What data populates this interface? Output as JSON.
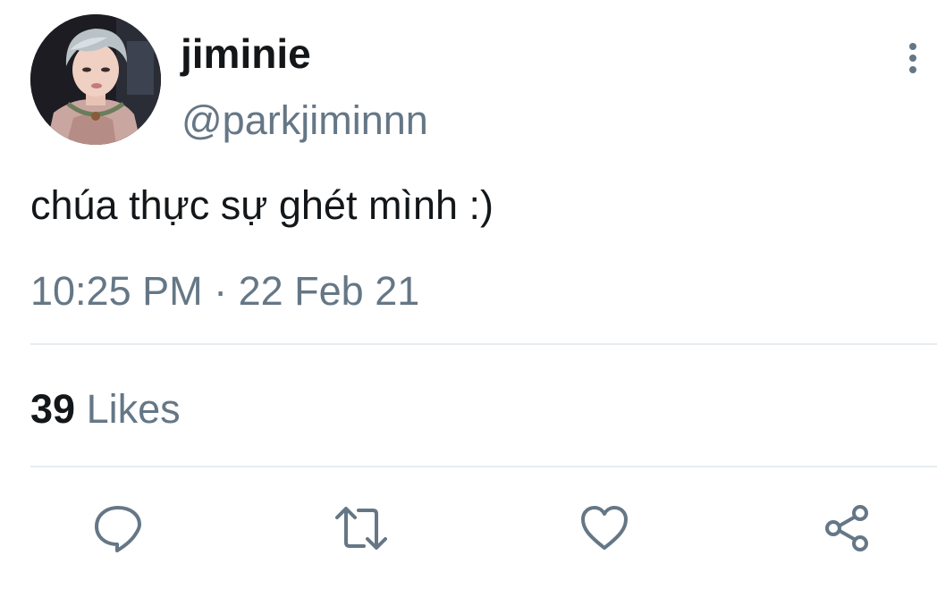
{
  "user": {
    "display_name": "jiminie",
    "handle": "@parkjiminnn"
  },
  "tweet": {
    "text": "chúa thực sự ghét mình :)",
    "timestamp": "10:25 PM · 22 Feb 21"
  },
  "stats": {
    "likes_count": "39",
    "likes_label": "Likes"
  },
  "actions": {
    "reply_icon": "reply-icon",
    "retweet_icon": "retweet-icon",
    "like_icon": "heart-icon",
    "share_icon": "share-icon",
    "more_icon": "more-vertical-icon"
  },
  "colors": {
    "primary_text": "#14171a",
    "secondary_text": "#657786",
    "divider": "#e6ecf0"
  }
}
